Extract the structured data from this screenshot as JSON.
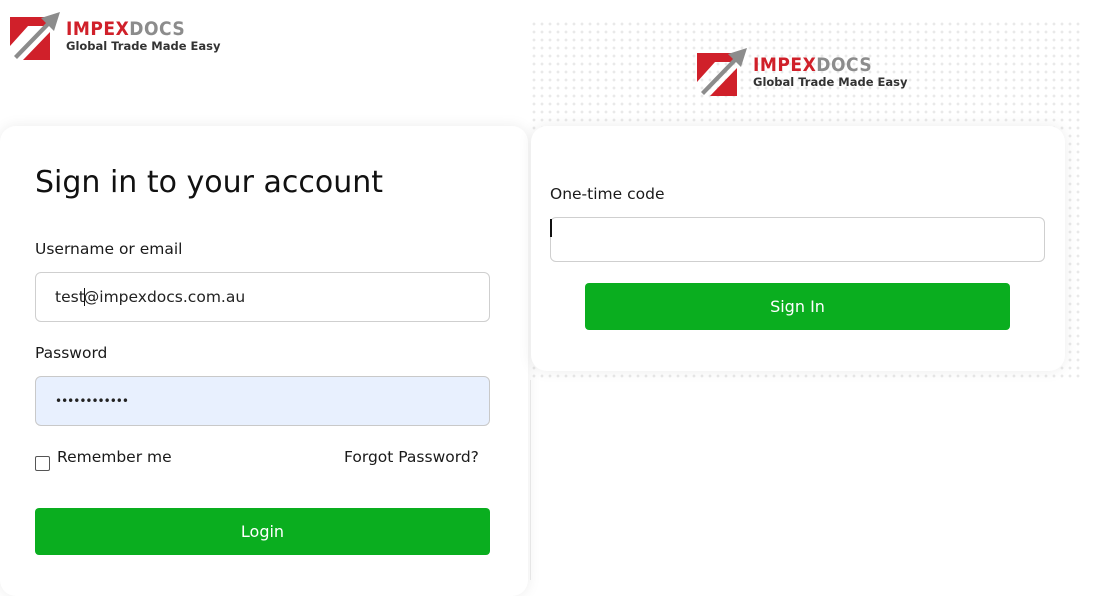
{
  "brand": {
    "name_part1": "IMPEX",
    "name_part2": "DOCS",
    "tagline": "Global Trade Made Easy",
    "colors": {
      "red": "#d0202a",
      "grey": "#8c8c8c"
    }
  },
  "login": {
    "title": "Sign in to your account",
    "username_label": "Username or email",
    "username_value_before_caret": "test",
    "username_value_after_caret": "@impexdocs.com.au",
    "password_label": "Password",
    "password_value": "••••••••••••",
    "remember_label": "Remember me",
    "forgot_label": "Forgot Password?",
    "login_button": "Login"
  },
  "otp": {
    "label": "One-time code",
    "value": "",
    "signin_button": "Sign In"
  },
  "colors": {
    "primary_button": "#0aae1f"
  }
}
